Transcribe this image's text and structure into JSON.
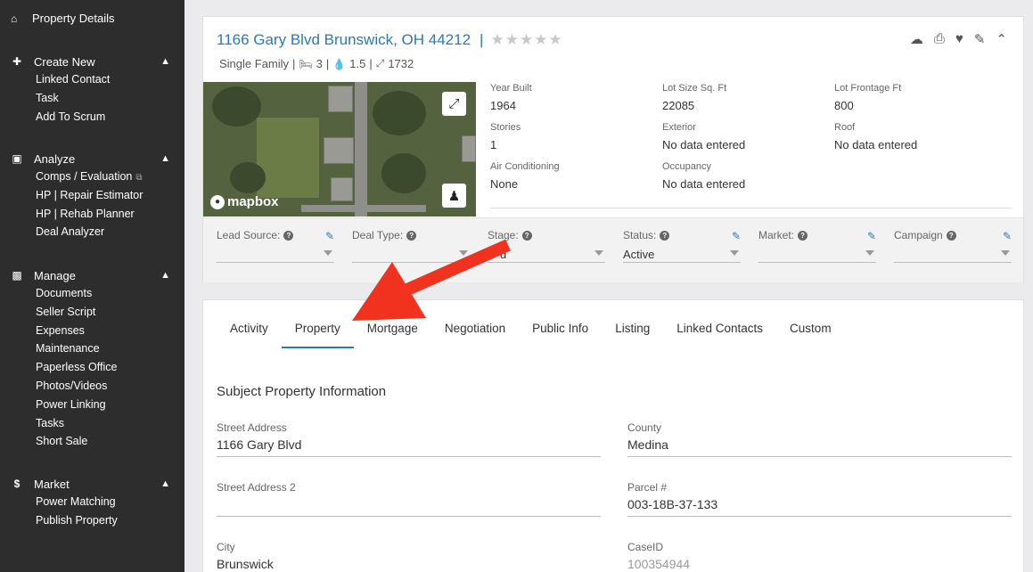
{
  "sidebar": {
    "top_item": {
      "icon": "home-icon",
      "label": "Property Details"
    },
    "sections": [
      {
        "icon": "plus-icon",
        "title": "Create New",
        "items": [
          "Linked Contact",
          "Task",
          "Add To Scrum"
        ]
      },
      {
        "icon": "laptop-icon",
        "title": "Analyze",
        "items": [
          "Comps / Evaluation",
          "HP | Repair Estimator",
          "HP | Rehab Planner",
          "Deal Analyzer"
        ]
      },
      {
        "icon": "briefcase-icon",
        "title": "Manage",
        "items": [
          "Documents",
          "Seller Script",
          "Expenses",
          "Maintenance",
          "Paperless Office",
          "Photos/Videos",
          "Power Linking",
          "Tasks",
          "Short Sale"
        ]
      },
      {
        "icon": "dollar-icon",
        "title": "Market",
        "items": [
          "Power Matching",
          "Publish Property"
        ]
      }
    ]
  },
  "property": {
    "address": "1166 Gary Blvd Brunswick, OH 44212",
    "separator": "|",
    "stars": "★★★★★",
    "type": "Single Family",
    "beds": "3",
    "baths": "1.5",
    "sqft": "1732",
    "map_logo": "mapbox"
  },
  "facts": [
    {
      "label": "Year Built",
      "value": "1964"
    },
    {
      "label": "Lot Size Sq. Ft",
      "value": "22085"
    },
    {
      "label": "Lot Frontage Ft",
      "value": "800"
    },
    {
      "label": "Stories",
      "value": "1"
    },
    {
      "label": "Exterior",
      "value": "No data entered"
    },
    {
      "label": "Roof",
      "value": "No data entered"
    },
    {
      "label": "Air Conditioning",
      "value": "None"
    },
    {
      "label": "Occupancy",
      "value": "No data entered"
    }
  ],
  "strip_fields": [
    {
      "label": "Lead Source:",
      "value": "",
      "editable": true
    },
    {
      "label": "Deal Type:",
      "value": "",
      "editable": false
    },
    {
      "label": "Stage:",
      "value": "d",
      "editable": false
    },
    {
      "label": "Status:",
      "value": "Active",
      "editable": true
    },
    {
      "label": "Market:",
      "value": "",
      "editable": true
    },
    {
      "label": "Campaign",
      "value": "",
      "editable": true
    }
  ],
  "tabs": [
    "Activity",
    "Property",
    "Mortgage",
    "Negotiation",
    "Public Info",
    "Listing",
    "Linked Contacts",
    "Custom"
  ],
  "active_tab": "Property",
  "form": {
    "section_title": "Subject Property Information",
    "street_address": {
      "label": "Street Address",
      "value": "1166 Gary Blvd"
    },
    "street_address_2": {
      "label": "Street Address 2",
      "value": ""
    },
    "city": {
      "label": "City",
      "value": "Brunswick"
    },
    "county": {
      "label": "County",
      "value": "Medina"
    },
    "parcel": {
      "label": "Parcel #",
      "value": "003-18B-37-133"
    },
    "case_id": {
      "label": "CaseID",
      "value": "100354944"
    }
  },
  "colors": {
    "accent": "#2d78b8",
    "sidebar": "#2d2d2d",
    "arrow": "#f0321e"
  }
}
